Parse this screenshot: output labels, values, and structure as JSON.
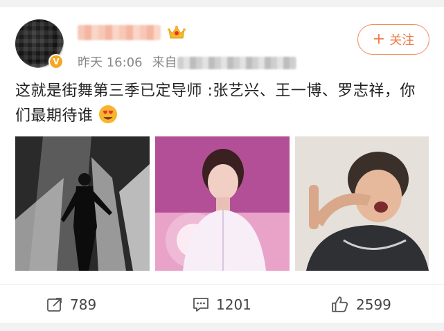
{
  "post": {
    "timestamp": "昨天 16:06",
    "source_prefix": "来自",
    "content": "这就是街舞第三季已定导师 :张艺兴、王一博、罗志祥，你们最期待谁"
  },
  "follow_button": {
    "plus": "+",
    "label": "关注"
  },
  "verify_badge": {
    "text": "V"
  },
  "icons": {
    "crown": "crown-icon",
    "emoji": "heart-eyes-emoji-icon",
    "repost": "repost-icon",
    "comment": "comment-icon",
    "like": "like-icon"
  },
  "actions": {
    "repost_count": "789",
    "comment_count": "1201",
    "like_count": "2599"
  },
  "colors": {
    "accent": "#f0794a",
    "meta_text": "#888888",
    "badge": "#f5a623"
  }
}
